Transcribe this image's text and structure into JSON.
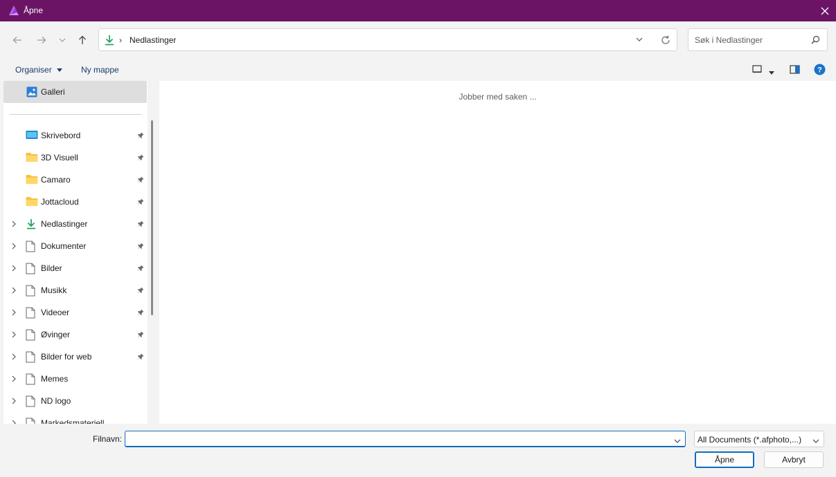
{
  "window": {
    "title": "Åpne"
  },
  "address_bar": {
    "current_folder": "Nedlastinger"
  },
  "search": {
    "placeholder": "Søk i Nedlastinger"
  },
  "toolbar": {
    "organize_label": "Organiser",
    "new_folder_label": "Ny mappe"
  },
  "sidebar": {
    "gallery_label": "Galleri",
    "items": [
      {
        "label": "Skrivebord",
        "icon": "desktop-icon",
        "expandable": false,
        "pinned": true
      },
      {
        "label": "3D Visuell",
        "icon": "folder-icon",
        "expandable": false,
        "pinned": true
      },
      {
        "label": "Camaro",
        "icon": "folder-icon",
        "expandable": false,
        "pinned": true
      },
      {
        "label": "Jottacloud",
        "icon": "folder-icon",
        "expandable": false,
        "pinned": true
      },
      {
        "label": "Nedlastinger",
        "icon": "download-icon",
        "expandable": true,
        "pinned": true
      },
      {
        "label": "Dokumenter",
        "icon": "document-icon",
        "expandable": true,
        "pinned": true
      },
      {
        "label": "Bilder",
        "icon": "document-icon",
        "expandable": true,
        "pinned": true
      },
      {
        "label": "Musikk",
        "icon": "document-icon",
        "expandable": true,
        "pinned": true
      },
      {
        "label": "Videoer",
        "icon": "document-icon",
        "expandable": true,
        "pinned": true
      },
      {
        "label": "Øvinger",
        "icon": "document-icon",
        "expandable": true,
        "pinned": true
      },
      {
        "label": "Bilder for web",
        "icon": "document-icon",
        "expandable": true,
        "pinned": true
      },
      {
        "label": "Memes",
        "icon": "document-icon",
        "expandable": true,
        "pinned": false
      },
      {
        "label": "ND logo",
        "icon": "document-icon",
        "expandable": true,
        "pinned": false
      },
      {
        "label": "Markedsmateriell",
        "icon": "document-icon",
        "expandable": true,
        "pinned": false
      }
    ]
  },
  "content": {
    "status_text": "Jobber med saken ..."
  },
  "footer": {
    "filename_label": "Filnavn:",
    "filename_value": "",
    "filetype_value": "All Documents (*.afphoto,...)",
    "open_label": "Åpne",
    "cancel_label": "Avbryt"
  },
  "colors": {
    "titlebar": "#6b1466",
    "accent": "#0f6cbd",
    "help": "#1a73c9",
    "download_green": "#1b9e5a",
    "folder_yellow": "#f5c242"
  }
}
